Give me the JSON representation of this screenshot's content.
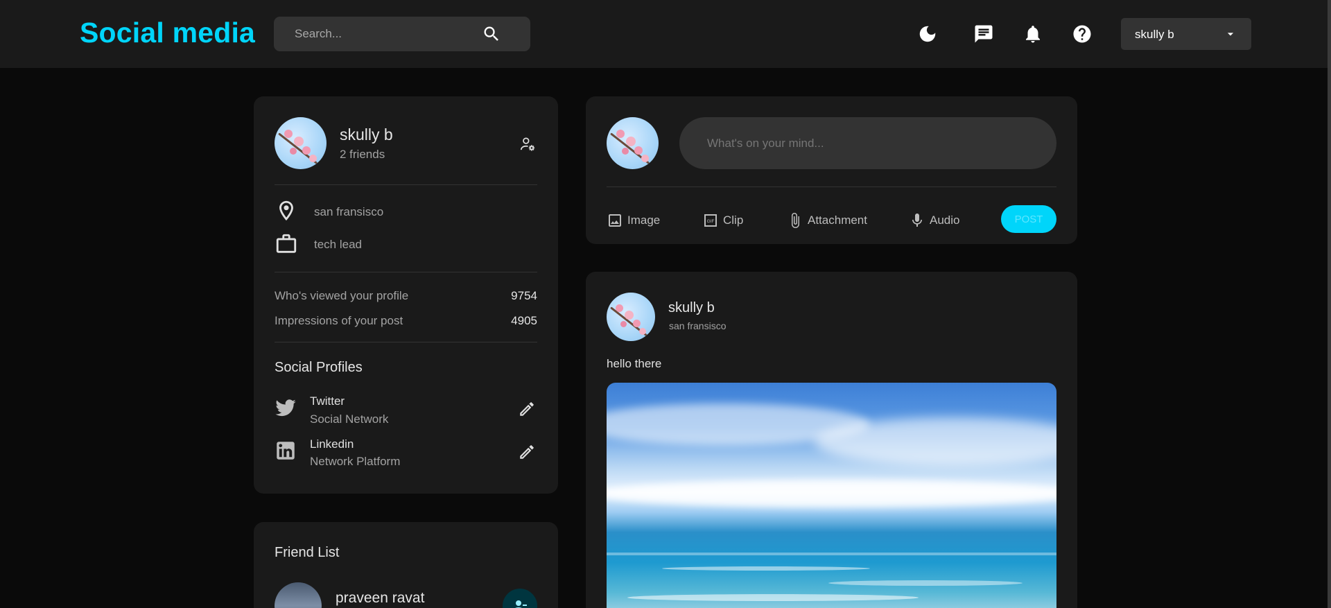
{
  "brand": "Social media",
  "search": {
    "placeholder": "Search..."
  },
  "user_menu": {
    "selected": "skully b"
  },
  "profile": {
    "name": "skully b",
    "friends": "2 friends",
    "location": "san fransisco",
    "occupation": "tech lead",
    "stats": [
      {
        "label": "Who's viewed your profile",
        "value": "9754"
      },
      {
        "label": "Impressions of your post",
        "value": "4905"
      }
    ],
    "social_title": "Social Profiles",
    "socials": [
      {
        "name": "Twitter",
        "sub": "Social Network"
      },
      {
        "name": "Linkedin",
        "sub": "Network Platform"
      }
    ]
  },
  "composer": {
    "placeholder": "What's on your mind...",
    "actions": [
      "Image",
      "Clip",
      "Attachment",
      "Audio"
    ],
    "post_label": "POST"
  },
  "post": {
    "author": "skully b",
    "location": "san fransisco",
    "text": "hello there"
  },
  "friend_list": {
    "title": "Friend List",
    "friends": [
      {
        "name": "praveen ravat"
      }
    ]
  },
  "colors": {
    "accent": "#00d5fa",
    "bg": "#0a0a0a",
    "panel": "#1a1a1a",
    "input": "#333333"
  }
}
